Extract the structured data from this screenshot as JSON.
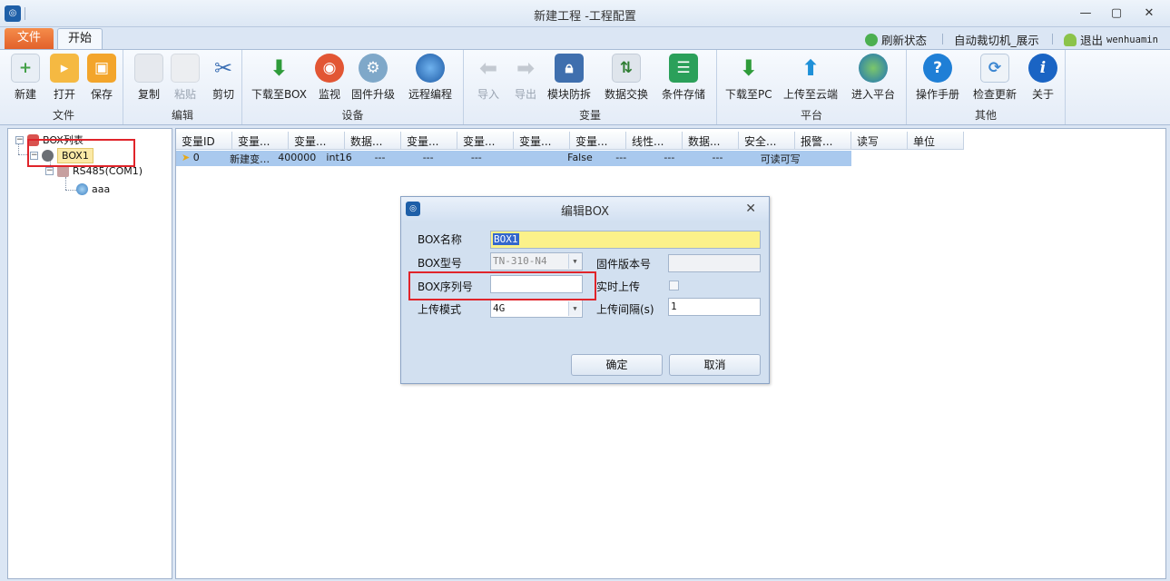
{
  "window": {
    "title": "新建工程 -工程配置",
    "app_icon": "app-logo"
  },
  "tabs": {
    "file": "文件",
    "start": "开始"
  },
  "top_right": {
    "refresh": "刷新状态",
    "project": "自动裁切机_展示",
    "logout": "退出",
    "user": "wenhuamin"
  },
  "ribbon": {
    "groups": {
      "file": "文件",
      "edit": "编辑",
      "device": "设备",
      "variable": "变量",
      "platform": "平台",
      "other": "其他"
    },
    "buttons": {
      "new": "新建",
      "open": "打开",
      "save": "保存",
      "copy": "复制",
      "paste": "粘贴",
      "cut": "剪切",
      "download_box": "下载至BOX",
      "monitor": "监视",
      "firmware": "固件升级",
      "remote": "远程编程",
      "import": "导入",
      "export": "导出",
      "module_protect": "模块防拆",
      "data_exchange": "数据交换",
      "cond_storage": "条件存储",
      "download_pc": "下载至PC",
      "upload_cloud": "上传至云端",
      "enter_platform": "进入平台",
      "manual": "操作手册",
      "check_update": "检查更新",
      "about": "关于"
    }
  },
  "tree": {
    "root": "BOX列表",
    "box": "BOX1",
    "port": "RS485(COM1)",
    "device": "aaa"
  },
  "grid": {
    "headers": [
      "变量ID",
      "变量...",
      "变量...",
      "数据...",
      "变量...",
      "变量...",
      "变量...",
      "变量...",
      "线性...",
      "数据...",
      "安全...",
      "报警...",
      "读写",
      "单位"
    ],
    "row": [
      "0",
      "新建变…",
      "400000",
      "int16",
      "---",
      "---",
      "---",
      "",
      "False",
      "---",
      "---",
      "---",
      "可读可写",
      ""
    ]
  },
  "dialog": {
    "title": "编辑BOX",
    "name_label": "BOX名称",
    "name_value": "BOX1",
    "model_label": "BOX型号",
    "model_value": "TN-310-N4",
    "serial_label": "BOX序列号",
    "serial_value": "",
    "firmware_label": "固件版本号",
    "firmware_value": "",
    "realtime_label": "实时上传",
    "mode_label": "上传模式",
    "mode_value": "4G",
    "interval_label": "上传间隔(s)",
    "interval_value": "1",
    "ok": "确定",
    "cancel": "取消"
  },
  "colors": {
    "accent_red": "#e0242a",
    "file_tab": "#e9692f",
    "selection": "#a9c9ee",
    "name_field": "#fbf18a"
  }
}
